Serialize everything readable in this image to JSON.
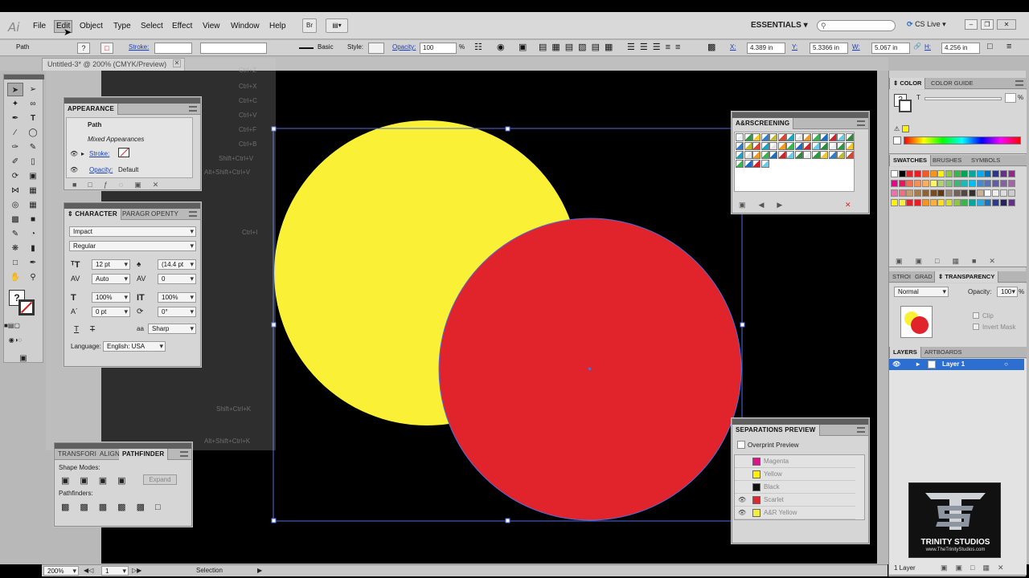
{
  "menubar": {
    "app_logo": "Ai",
    "items": [
      "File",
      "Edit",
      "Object",
      "Type",
      "Select",
      "Effect",
      "View",
      "Window",
      "Help"
    ],
    "bridge_label": "Br",
    "workspace": "ESSENTIALS",
    "cslive": "CS Live"
  },
  "controlbar": {
    "selection_type": "Path",
    "stroke_label": "Stroke:",
    "brush_label": "Basic",
    "style_label": "Style:",
    "opacity_label": "Opacity:",
    "opacity_value": "100",
    "opacity_unit": "%",
    "x_label": "X:",
    "x_value": "4.389 in",
    "y_label": "Y:",
    "y_value": "5.3366 in",
    "w_label": "W:",
    "w_value": "5.067 in",
    "h_label": "H:",
    "h_value": "4.256 in"
  },
  "document": {
    "tab_title": "Untitled-3* @ 200% (CMYK/Preview)"
  },
  "appearance": {
    "tab": "APPEARANCE",
    "object": "Path",
    "mixed": "Mixed Appearances",
    "stroke_label": "Stroke:",
    "opacity_label": "Opacity:",
    "opacity_value": "Default"
  },
  "character": {
    "tabs": [
      "CHARACTER",
      "PARAGR",
      "OPENTY"
    ],
    "font": "Impact",
    "style": "Regular",
    "size": "12 pt",
    "leading": "(14.4 pt",
    "kerning": "Auto",
    "tracking": "0",
    "vscale": "100%",
    "hscale": "100%",
    "baseline": "0 pt",
    "rotation": "0°",
    "aa_label": "aa",
    "antialias": "Sharp",
    "language_label": "Language:",
    "language": "English: USA"
  },
  "pathfinder": {
    "tabs": [
      "TRANSFORI",
      "ALIGN",
      "PATHFINDER"
    ],
    "shape_modes": "Shape Modes:",
    "expand": "Expand",
    "pathfinders": "Pathfinders:"
  },
  "ar_screening": {
    "title": "A&RSCREENING"
  },
  "separations": {
    "title": "SEPARATIONS PREVIEW",
    "overprint": "Overprint Preview",
    "inks": [
      {
        "name": "Magenta",
        "color": "#e0118c"
      },
      {
        "name": "Yellow",
        "color": "#fff200"
      },
      {
        "name": "Black",
        "color": "#111111"
      },
      {
        "name": "Scarlet",
        "color": "#e1262e"
      },
      {
        "name": "A&R Yellow",
        "color": "#f4ef3a"
      }
    ]
  },
  "dock": {
    "color_tabs": [
      "COLOR",
      "COLOR GUIDE"
    ],
    "color_t": "T",
    "color_pct": "%",
    "swatch_tabs": [
      "SWATCHES",
      "BRUSHES",
      "SYMBOLS"
    ],
    "trans_tabs": [
      "STROI",
      "GRAD",
      "TRANSPARENCY"
    ],
    "blend_mode": "Normal",
    "opacity_label": "Opacity:",
    "opacity_value": "100",
    "opacity_unit": "%",
    "clip": "Clip",
    "invert_mask": "Invert Mask",
    "layers_tabs": [
      "LAYERS",
      "ARTBOARDS"
    ],
    "layer_name": "Layer 1",
    "layers_count": "1 Layer"
  },
  "watermark": {
    "name": "TRINITY STUDIOS",
    "url": "www.TheTrinityStudios.com"
  },
  "status": {
    "zoom": "200%",
    "artboard": "1",
    "tool": "Selection"
  },
  "colors": {
    "yellow_circle": "#faf136",
    "red_circle": "#e1232b",
    "selection": "#4f6ee0",
    "layer_highlight": "#2d6fd0"
  }
}
